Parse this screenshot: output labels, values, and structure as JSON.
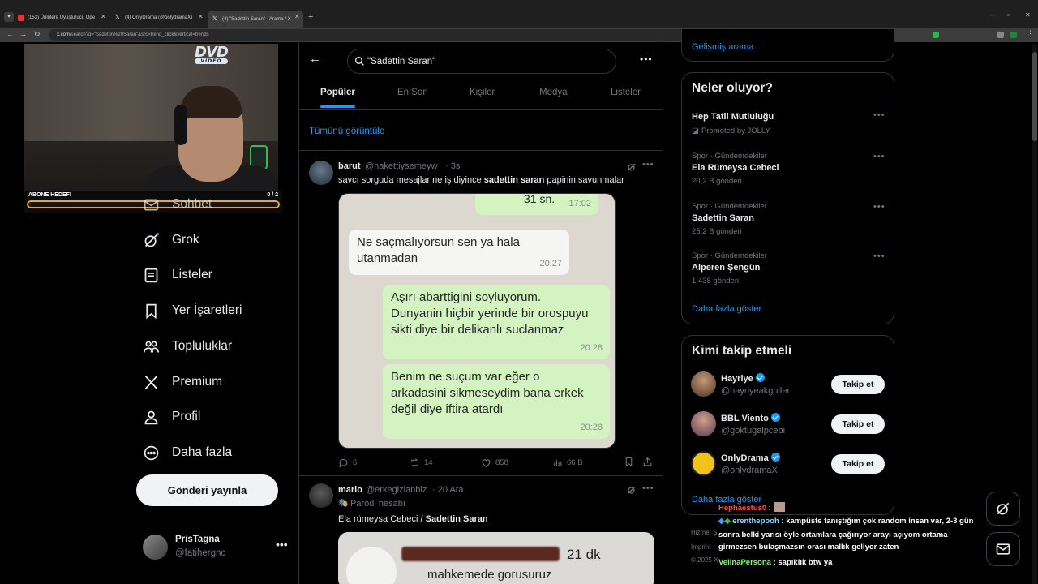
{
  "browser": {
    "tabs": [
      {
        "title": "(153) Ünlülere Uyuşturucu Ope",
        "color": "#ff2b2b"
      },
      {
        "title": "(4) OnlyDrama (@onlydramaX)",
        "color": "#ffffff"
      },
      {
        "title": "(4) \"Sadettin Saran\" - Arama / X",
        "color": "#ffffff"
      }
    ],
    "url_host": "x.com",
    "url_path": "/search?q=\"Sadettin%20Saran\"&src=trend_click&vertical=trends"
  },
  "overlay": {
    "dvd_logo": "DVD",
    "dvd_sub": "VIDEO",
    "goal_label": "ABONE HEDEFI",
    "goal_count": "0 / 2"
  },
  "nav": {
    "items": [
      {
        "label": "Sohbet",
        "icon": "mail-icon"
      },
      {
        "label": "Grok",
        "icon": "grok-icon"
      },
      {
        "label": "Listeler",
        "icon": "list-icon"
      },
      {
        "label": "Yer İşaretleri",
        "icon": "bookmark-icon"
      },
      {
        "label": "Topluluklar",
        "icon": "communities-icon"
      },
      {
        "label": "Premium",
        "icon": "x-logo-icon"
      },
      {
        "label": "Profil",
        "icon": "profile-icon"
      },
      {
        "label": "Daha fazla",
        "icon": "more-circle-icon"
      }
    ],
    "post_button": "Gönderi yayınla",
    "account": {
      "name": "PrisTagna",
      "handle": "@fatihergnc"
    }
  },
  "search": {
    "query": "\"Sadettin Saran\"",
    "tabs": [
      "Popüler",
      "En Son",
      "Kişiler",
      "Medya",
      "Listeler"
    ],
    "view_all": "Tümünü görüntüle"
  },
  "tweets": [
    {
      "name": "barut",
      "handle": "@hakettiysemeyw",
      "time": "· 3s",
      "text_before": "savcı sorguda mesajlar ne iş diyince ",
      "text_bold": "sadettin saran",
      "text_after": " papinin savunmalar",
      "image": {
        "top_partial": "31 sn.",
        "top_time": "17:02",
        "bubbles": [
          {
            "text": "Ne saçmalıyorsun sen ya hala utanmadan",
            "time": "20:27"
          },
          {
            "text": "Aşırı abarttigini soyluyorum. Dunyanin hiçbir yerinde bir orospuyu sikti diye bir delikanlı suclanmaz",
            "time": "20:28"
          },
          {
            "text": "Benim ne suçum var eğer o arkadasini sikmeseydim bana erkek değil diye iftira atardı",
            "time": "20:28"
          }
        ]
      },
      "replies": "6",
      "reposts": "14",
      "likes": "858",
      "views": "66 B"
    },
    {
      "name": "mario",
      "handle": "@erkegizlanbiz",
      "time": "· 20 Ara",
      "label": "Parodi hesabı",
      "text_before": "Ela rümeysa Cebeci / ",
      "text_bold": "Sadettin Saran",
      "image_time": "21 dk",
      "image_partial": "mahkemede gorusuruz"
    }
  ],
  "sidebar": {
    "advanced_search": "Gelişmiş arama",
    "trends_title": "Neler oluyor?",
    "trends": [
      {
        "meta": "",
        "title": "Hep Tatil Mutluluğu",
        "sub": "Promoted by JOLLY"
      },
      {
        "meta": "Spor · Gündemdekiler",
        "title": "Ela Rümeysa Cebeci",
        "sub": "20,2 B gönderi"
      },
      {
        "meta": "Spor · Gündemdekiler",
        "title": "Sadettin Saran",
        "sub": "25,2 B gönderi"
      },
      {
        "meta": "Spor · Gündemdekiler",
        "title": "Alperen Şengün",
        "sub": "1.438 gönderi"
      }
    ],
    "show_more": "Daha fazla göster",
    "follow_title": "Kimi takip etmeli",
    "follow": [
      {
        "name": "Hayriye",
        "handle": "@hayriyeakguller"
      },
      {
        "name": "BBL Viento",
        "handle": "@goktugalpcebi"
      },
      {
        "name": "OnlyDrama",
        "handle": "@onlydramaX"
      }
    ],
    "follow_button": "Takip et",
    "show_more_2": "Daha fazla göster",
    "footer": [
      "Hizmet Ş",
      "Imprint",
      "© 2025 X"
    ]
  },
  "chat": [
    {
      "user": "Hephaestus0",
      "color": "#ff4d4d",
      "msg": " : "
    },
    {
      "user": "erenthepooh",
      "color": "#8fd3ff",
      "msg": " : kampüste tanıştığım çok random insan var, 2-3 gün"
    },
    {
      "user": "",
      "color": "#ffffff",
      "msg": "sonra belki yarısı öyle ortamlara çağırıyor arayı açıyom ortama"
    },
    {
      "user": "",
      "color": "#ffffff",
      "msg": "girmezsen bulaşmazsın orası mallık geliyor zaten"
    },
    {
      "user": "VelinaPersona",
      "color": "#7dff5c",
      "msg": " : sapıklık btw ya"
    }
  ]
}
